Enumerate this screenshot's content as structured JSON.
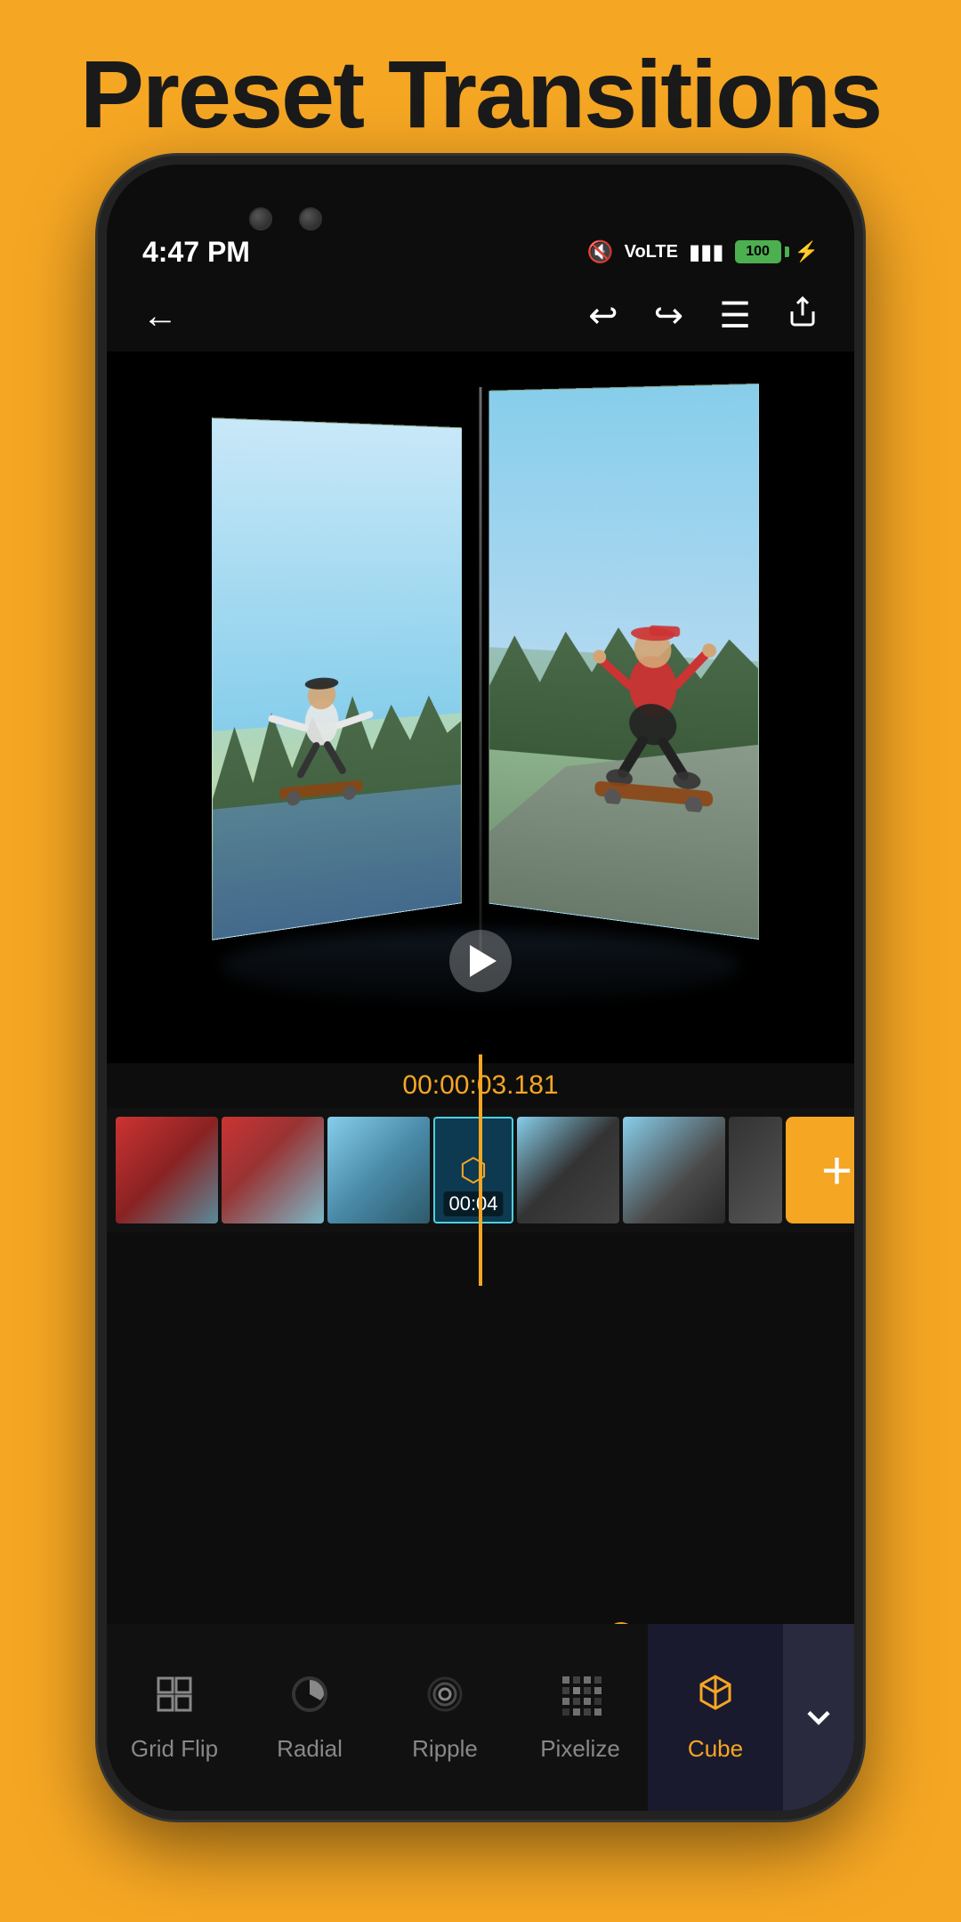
{
  "page": {
    "title": "Preset Transitions",
    "background_color": "#F5A623"
  },
  "status_bar": {
    "time": "4:47 PM",
    "battery_level": "100",
    "battery_color": "#4CAF50"
  },
  "toolbar": {
    "back_label": "←",
    "undo_label": "↩",
    "redo_label": "↪",
    "menu_label": "☰",
    "share_label": "⬆"
  },
  "video_preview": {
    "timestamp": "00:00:03.181",
    "clip_time": "00:04"
  },
  "timeline": {
    "timestamp": "00:00:03.181",
    "clips": [
      {
        "id": 1,
        "active": false
      },
      {
        "id": 2,
        "active": false
      },
      {
        "id": 3,
        "active": false
      },
      {
        "id": 4,
        "active": true,
        "transition": true,
        "label": "00:04"
      },
      {
        "id": 5,
        "active": false
      },
      {
        "id": 6,
        "active": false
      }
    ]
  },
  "bottom_nav": {
    "items": [
      {
        "id": "grid-flip",
        "label": "Grid Flip",
        "icon": "⊞",
        "active": false
      },
      {
        "id": "radial",
        "label": "Radial",
        "icon": "◑",
        "active": false
      },
      {
        "id": "ripple",
        "label": "Ripple",
        "icon": "◉",
        "active": false
      },
      {
        "id": "pixelize",
        "label": "Pixelize",
        "icon": "⊞",
        "active": false
      },
      {
        "id": "cube",
        "label": "Cube",
        "icon": "⬡",
        "active": true
      }
    ],
    "chevron_label": "∨"
  }
}
